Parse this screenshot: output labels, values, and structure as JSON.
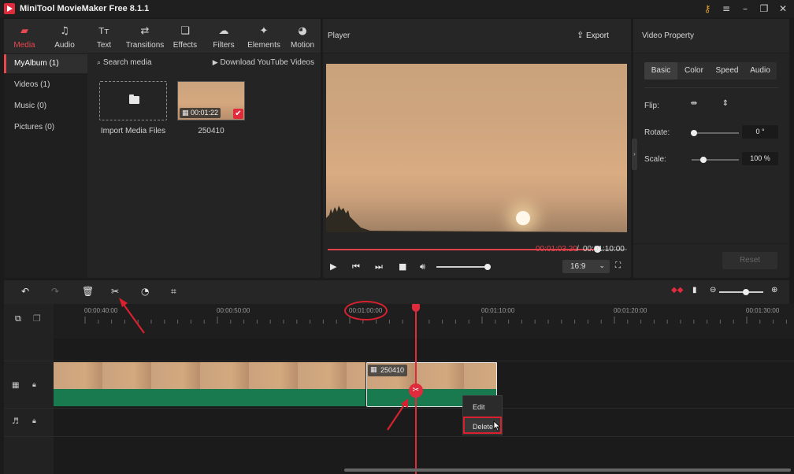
{
  "app": {
    "title": "MiniTool MovieMaker Free 8.1.1"
  },
  "media_tabs": [
    {
      "label": "Media",
      "icon": "folder-icon"
    },
    {
      "label": "Audio",
      "icon": "music-icon"
    },
    {
      "label": "Text",
      "icon": "text-icon"
    },
    {
      "label": "Transitions",
      "icon": "transitions-icon"
    },
    {
      "label": "Effects",
      "icon": "effects-icon"
    },
    {
      "label": "Filters",
      "icon": "filters-icon"
    },
    {
      "label": "Elements",
      "icon": "elements-icon"
    },
    {
      "label": "Motion",
      "icon": "motion-icon"
    }
  ],
  "sidebar": {
    "items": [
      {
        "label": "MyAlbum (1)",
        "active": true
      },
      {
        "label": "Videos (1)"
      },
      {
        "label": "Music (0)"
      },
      {
        "label": "Pictures (0)"
      }
    ]
  },
  "media": {
    "search_label": "Search media",
    "download_label": "Download YouTube Videos",
    "import_label": "Import Media Files",
    "clip_name": "250410",
    "clip_duration": "00:01:22"
  },
  "player": {
    "title": "Player",
    "export_label": "Export",
    "current_time": "00:01:03.20",
    "separator": " / ",
    "total_time": "00:01:10:00",
    "aspect_ratio": "16:9",
    "progress": 0.9,
    "volume": 1.0
  },
  "property": {
    "title": "Video Property",
    "tabs": [
      "Basic",
      "Color",
      "Speed",
      "Audio"
    ],
    "flip_label": "Flip:",
    "rotate_label": "Rotate:",
    "rotate_value": "0 °",
    "scale_label": "Scale:",
    "scale_value": "100 %",
    "reset_label": "Reset"
  },
  "timeline": {
    "ruler_labels": [
      "00:00:40:00",
      "00:00:50:00",
      "00:01:00:00",
      "00:01:10:00",
      "00:01:20:00",
      "00:01:30:00"
    ],
    "clip_label": "250410",
    "context_menu": [
      "Edit",
      "Delete"
    ]
  },
  "colors": {
    "accent": "#e02b3c",
    "audio_track": "#197a50",
    "panel": "#242424"
  }
}
